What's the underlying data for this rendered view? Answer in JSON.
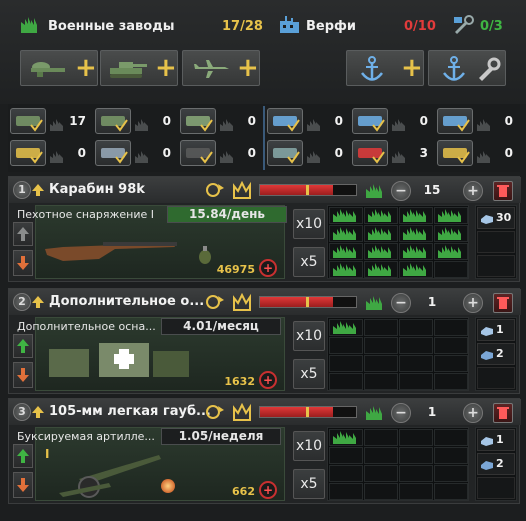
{
  "header": {
    "mil_title": "Военные заводы",
    "mil_count": "17/28",
    "dock_title": "Верфи",
    "dock_count": "0/10",
    "repair_count": "0/3"
  },
  "stockpile": {
    "row1": [
      "17",
      "0",
      "0",
      "0",
      "0",
      "0"
    ],
    "row2": [
      "0",
      "0",
      "0",
      "0",
      "3",
      "0"
    ]
  },
  "lines": [
    {
      "index": "1",
      "name": "Карабин 98k",
      "factories": "15",
      "category": "Пехотное снаряжение I",
      "rate": "15.84/день",
      "cost": "46975",
      "x10": "x10",
      "x5": "x5",
      "res1": "30"
    },
    {
      "index": "2",
      "name": "Дополнительное о...",
      "factories": "1",
      "category": "Дополнительное осна...",
      "rate": "4.01/месяц",
      "cost": "1632",
      "x10": "x10",
      "x5": "x5",
      "res1": "1",
      "res2": "2"
    },
    {
      "index": "3",
      "name": "105-мм легкая гауб...",
      "factories": "1",
      "category": "Буксируемая артилле...",
      "rate": "1.05/неделя",
      "cost": "662",
      "x10": "x10",
      "x5": "x5",
      "res1": "1",
      "res2": "2",
      "tier": "I"
    }
  ],
  "colors": {
    "gold": "#e7c24a",
    "red": "#e23b3b",
    "green": "#3fb543",
    "green_rate_bg": "#2f6a2f"
  }
}
